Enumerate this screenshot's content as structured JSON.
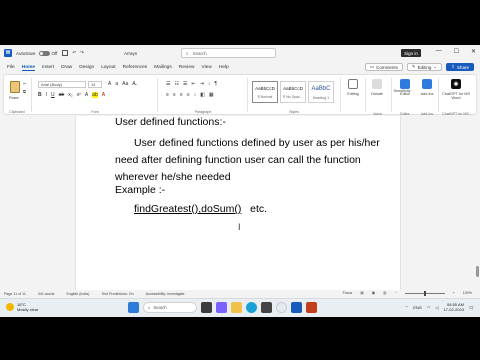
{
  "titlebar": {
    "autosave_label": "AutoSave",
    "autosave_state": "Off",
    "doc_title": "Arrays",
    "search_placeholder": "Search",
    "signin_label": "Sign in"
  },
  "menu": {
    "tabs": [
      "File",
      "Home",
      "Insert",
      "Draw",
      "Design",
      "Layout",
      "References",
      "Mailings",
      "Review",
      "View",
      "Help"
    ],
    "active_tab": "Home",
    "comments_label": "Comments",
    "editing_label": "Editing",
    "share_label": "Share"
  },
  "ribbon": {
    "clipboard_label": "Clipboard",
    "paste_label": "Paste",
    "font_name": "Arial (Body)",
    "font_size": "14",
    "font_group_label": "Font",
    "paragraph_group_label": "Paragraph",
    "styles_group_label": "Styles",
    "styles": [
      {
        "sample": "AaBbCcD",
        "name": "¶ Normal"
      },
      {
        "sample": "AaBbCcD",
        "name": "¶ No Spac..."
      },
      {
        "sample": "AaBbC",
        "name": "Heading 1"
      }
    ],
    "editing_btn": "Editing",
    "voice_label": "Voice",
    "dictate_btn": "Dictate",
    "sensitivity_label": "Sensitivity",
    "editor_label": "Editor",
    "editor_btn": "Editor",
    "addins_label": "Add-ins",
    "addins_btn": "Add-ins",
    "chatgpt_label": "ChatGPT for MS...",
    "chatgpt_btn": "ChatGPT for MS Word",
    "accent_color": "#185abd"
  },
  "document": {
    "heading": "User defined functions:-",
    "paragraph": "User defined functions defined by user as per his/her need after defining function user can call the function wherever he/she needed",
    "example_label": "Example :-",
    "code_underlined": "findGreatest(),doSum()",
    "code_rest": "etc."
  },
  "statusbar": {
    "page": "Page 11 of 11",
    "words": "341 words",
    "language": "English (India)",
    "predictions": "Text Predictions: On",
    "accessibility": "Accessibility: Investigate",
    "focus": "Focus",
    "zoom": "100%"
  },
  "taskbar": {
    "temp": "18°C",
    "weather": "Mostly clear",
    "search_placeholder": "Search",
    "language": "ENG",
    "time": "08:55 AM",
    "date": "17-02-2023"
  }
}
